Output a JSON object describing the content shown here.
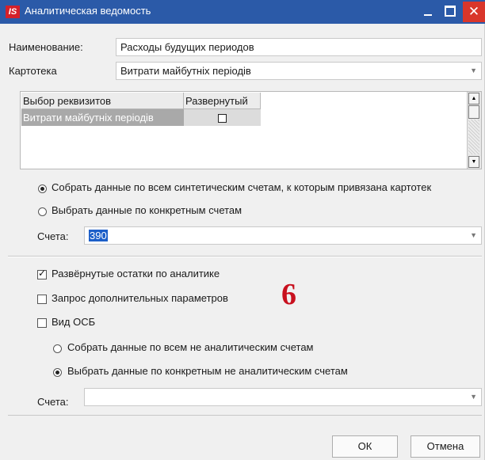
{
  "window": {
    "title": "Аналитическая ведомость",
    "app_badge": "IS",
    "min_label": "_",
    "close_label": "✕"
  },
  "form": {
    "name_label": "Наименование:",
    "name_value": "Расходы будущих периодов",
    "card_label": "Картотека",
    "card_value": "Витрати майбутніх періодів"
  },
  "grid": {
    "col_requisites": "Выбор реквизитов",
    "col_expanded": "Развернутый",
    "rows": [
      {
        "requisite": "Витрати майбутніх періодів",
        "expanded": false
      }
    ]
  },
  "options": {
    "radio_all": "Собрать данные по всем синтетическим счетам, к которым привязана картотек",
    "radio_specific": "Выбрать данные по конкретным счетам",
    "radio_selected": "all",
    "accounts_label": "Счета:",
    "accounts_value": "390"
  },
  "extra": {
    "cb_balances": "Развёрнутые остатки по аналитике",
    "cb_balances_checked": true,
    "cb_params": "Запрос дополнительных параметров",
    "cb_params_checked": false,
    "cb_osb": "Вид ОСБ",
    "cb_osb_checked": false,
    "radio_non_all": "Собрать данные по всем не аналитическим счетам",
    "radio_non_specific": "Выбрать данные по конкретным не аналитическим счетам",
    "radio_non_selected": "specific",
    "accounts2_label": "Счета:",
    "accounts2_value": ""
  },
  "annotation": "6",
  "buttons": {
    "ok": "ОК",
    "cancel": "Отмена"
  },
  "colors": {
    "titlebar": "#2b5aa8",
    "close": "#d9362b",
    "annotation": "#c8101e"
  }
}
